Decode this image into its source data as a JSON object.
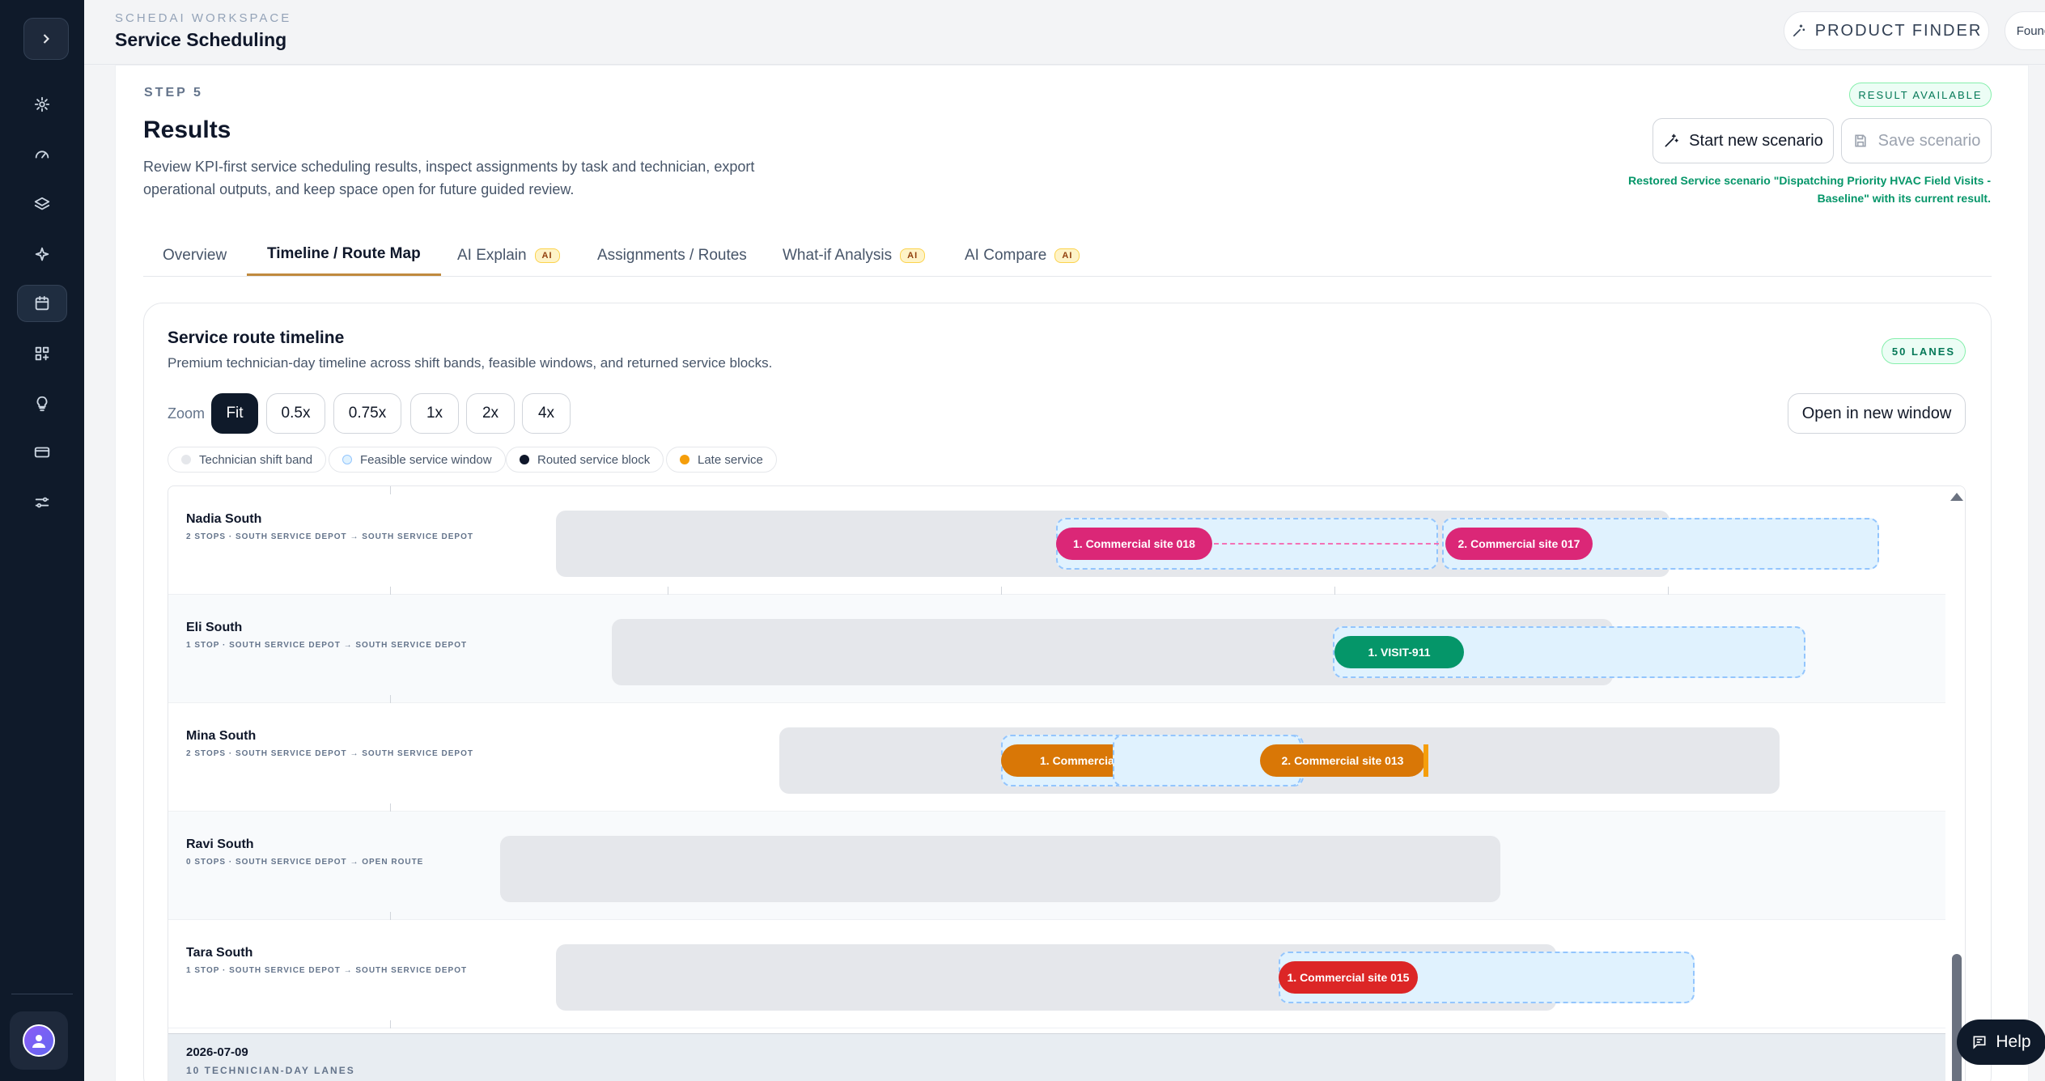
{
  "topbar": {
    "workspace": "SCHEDAI WORKSPACE",
    "title": "Service Scheduling",
    "product_finder": "PRODUCT FINDER",
    "account": "Founder account"
  },
  "results": {
    "step": "STEP 5",
    "title": "Results",
    "description": "Review KPI-first service scheduling results, inspect assignments by task and technician, export operational outputs, and keep space open for future guided review.",
    "badge": "RESULT AVAILABLE",
    "start_new": "Start new scenario",
    "save": "Save scenario",
    "restored": "Restored Service scenario \"Dispatching Priority HVAC Field Visits - Baseline\" with its current result."
  },
  "tabs": [
    {
      "label": "Overview"
    },
    {
      "label": "Timeline / Route Map"
    },
    {
      "label": "AI Explain",
      "badge": "AI"
    },
    {
      "label": "Assignments / Routes"
    },
    {
      "label": "What-if Analysis",
      "badge": "AI"
    },
    {
      "label": "AI Compare",
      "badge": "AI"
    }
  ],
  "timeline": {
    "title": "Service route timeline",
    "subtitle": "Premium technician-day timeline across shift bands, feasible windows, and returned service blocks.",
    "lanes_badge": "50 LANES",
    "zoom_label": "Zoom",
    "zoom_options": [
      "Fit",
      "0.5x",
      "0.75x",
      "1x",
      "2x",
      "4x"
    ],
    "zoom_selected": "Fit",
    "open_window": "Open in new window",
    "legend": [
      {
        "label": "Technician shift band",
        "color": "#e5e7eb"
      },
      {
        "label": "Feasible service window",
        "color": "#e0f2fe"
      },
      {
        "label": "Routed service block",
        "color": "#0f172a"
      },
      {
        "label": "Late service",
        "color": "#f59e0b"
      }
    ],
    "lanes": [
      {
        "name": "Nadia South",
        "sub": "2 STOPS · SOUTH SERVICE DEPOT → SOUTH SERVICE DEPOT",
        "blocks": [
          "1. Commercial site 018",
          "2. Commercial site 017"
        ]
      },
      {
        "name": "Eli South",
        "sub": "1 STOP · SOUTH SERVICE DEPOT → SOUTH SERVICE DEPOT",
        "blocks": [
          "1. VISIT-911"
        ]
      },
      {
        "name": "Mina South",
        "sub": "2 STOPS · SOUTH SERVICE DEPOT → SOUTH SERVICE DEPOT",
        "blocks": [
          "1. Commercial site 014",
          "2. Commercial site 013"
        ]
      },
      {
        "name": "Ravi South",
        "sub": "0 STOPS · SOUTH SERVICE DEPOT → OPEN ROUTE",
        "blocks": []
      },
      {
        "name": "Tara South",
        "sub": "1 STOP · SOUTH SERVICE DEPOT → SOUTH SERVICE DEPOT",
        "blocks": [
          "1. Commercial site 015"
        ]
      }
    ],
    "group": {
      "date": "2026-07-09",
      "count": "10 TECHNICIAN-DAY LANES"
    }
  },
  "help": "Help",
  "icons": [
    "chevron-right-icon",
    "settings-icon",
    "gauge-icon",
    "layers-icon",
    "sparkle-icon",
    "calendar-icon",
    "grid-plus-icon",
    "bulb-icon",
    "card-icon",
    "sliders-icon"
  ]
}
